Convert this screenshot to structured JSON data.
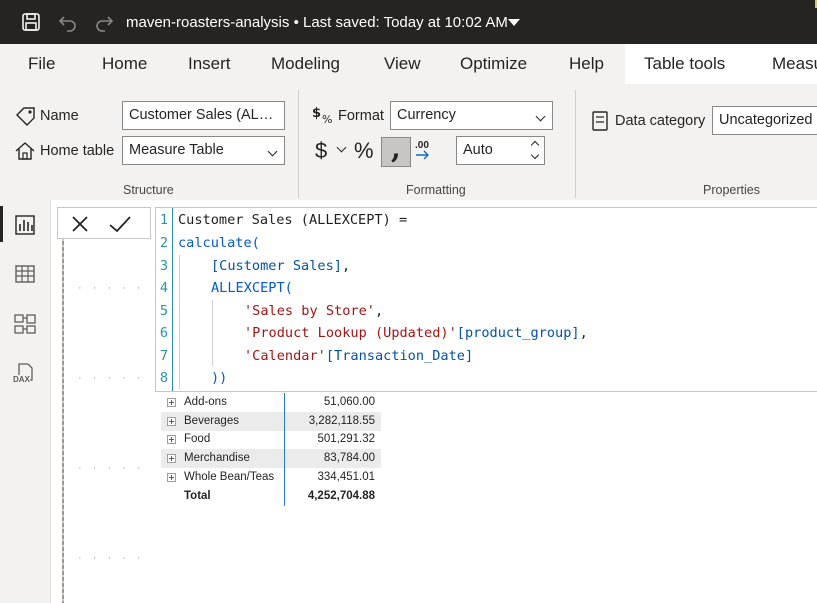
{
  "titlebar": {
    "file_name": "maven-roasters-analysis",
    "saved_status": "Last saved: Today at 10:02 AM",
    "icons": [
      "save-icon",
      "undo-icon",
      "redo-icon"
    ]
  },
  "menu": {
    "items": [
      "File",
      "Home",
      "Insert",
      "Modeling",
      "View",
      "Optimize",
      "Help"
    ],
    "context_tabs": [
      "Table tools",
      "Measu"
    ]
  },
  "ribbon": {
    "structure": {
      "group_label": "Structure",
      "name_label": "Name",
      "name_value": "Customer Sales (AL…",
      "home_table_label": "Home table",
      "home_table_value": "Measure Table"
    },
    "formatting": {
      "group_label": "Formatting",
      "format_label": "Format",
      "format_value": "Currency",
      "currency_symbol": "$",
      "percent_symbol": "%",
      "comma_symbol": ",",
      "decimal_icon": ".00",
      "decimals_value": "Auto"
    },
    "properties": {
      "group_label": "Properties",
      "data_category_label": "Data category",
      "data_category_value": "Uncategorized"
    }
  },
  "left_rail": {
    "icons": [
      "report-view-icon",
      "table-view-icon",
      "model-view-icon",
      "dax-query-view-icon"
    ],
    "dax_label": "DAX"
  },
  "formula_bar": {
    "line_numbers": [
      "1",
      "2",
      "3",
      "4",
      "5",
      "6",
      "7",
      "8"
    ],
    "lines": [
      {
        "t1": "Customer Sales ",
        "t2": "(",
        "t3": "ALLEXCEPT",
        "t4": ") ="
      },
      {
        "t1": "calculate",
        "t2": "("
      },
      {
        "t1": "[Customer Sales]",
        "t2": ","
      },
      {
        "t1": "ALLEXCEPT",
        "t2": "("
      },
      {
        "t1": "'Sales by Store'",
        "t2": ","
      },
      {
        "t1": "'Product Lookup (Updated)'",
        "t2": "[product_group]",
        "t3": ","
      },
      {
        "t1": "'Calendar'",
        "t2": "[Transaction_Date]"
      },
      {
        "t1": "))"
      }
    ]
  },
  "matrix": {
    "rows": [
      {
        "category": "Add-ons",
        "value": "51,060.00"
      },
      {
        "category": "Beverages",
        "value": "3,282,118.55"
      },
      {
        "category": "Food",
        "value": "501,291.32"
      },
      {
        "category": "Merchandise",
        "value": "83,784.00"
      },
      {
        "category": "Whole Bean/Teas",
        "value": "334,451.01"
      }
    ],
    "total_label": "Total",
    "total_value": "4,252,704.88"
  },
  "colors": {
    "titlebar": "#252423",
    "ribbon": "#f3f2f1",
    "line_number": "#2b91af",
    "dax_function": "#035aca",
    "dax_string": "#a31515"
  }
}
